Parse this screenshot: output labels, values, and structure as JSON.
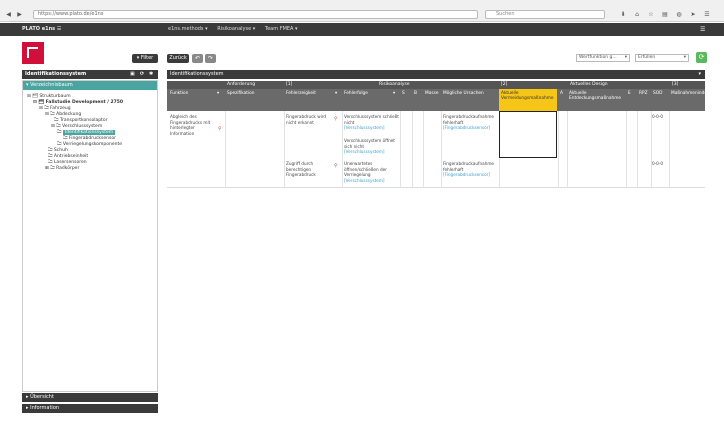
{
  "browser": {
    "url": "https://www.plato.de/e1ns",
    "search_placeholder": "Suchen",
    "back_icon": "back-arrow-icon",
    "forward_icon": "forward-arrow-icon"
  },
  "app": {
    "brand": "PLATO e1ns ☰",
    "breadcrumbs": [
      "e1ns.methods ▾",
      "Risikoanalyse ▾",
      "Team FMEA ▾"
    ]
  },
  "sidebar": {
    "filter_label": "▾ Filter",
    "panel_title": "Identifikationssystem",
    "active_tab": "▾ Verzeichnisbaum",
    "tree": [
      "⊟ 🗂 Strukturbaum",
      "⊟ 🗂 Fallstudie Development / 2750",
      "⊟ 🗀 Fahrzeug",
      "⊟ 🗀 Abdeckung",
      "🗀 Transportkonsolaptor",
      "⊟ 🗀 Verschlusssystem",
      "Identifikationssystem",
      "🗀 Fingerabdrucksensor",
      "🗀 Verriegelungskomponente",
      "🗀 Schuh",
      "🗀 Antriebseinheit",
      "🗀 Lasersensoren",
      "⊞ 🗀 Radkörper"
    ],
    "footer": [
      "▸ Übersicht",
      "▸ Information"
    ]
  },
  "toolbar": {
    "back_label": "Zurück",
    "select1": "Wertfunktion g...",
    "select2": "Erfüllen"
  },
  "main": {
    "title": "Identifikationssystem",
    "band1": [
      "Anforderung",
      "[1]",
      "Risikoanalyse",
      "[2]",
      "Aktuelles Design",
      "[3]"
    ],
    "columns": [
      "Funktion",
      "Spezifikation",
      "Fehlerzeigkeit",
      "Fehlerfolge",
      "S",
      "B",
      "Masse",
      "Mögliche Ursachen",
      "Aktuelle Vermeidungsmaßnahme",
      "A",
      "Aktuelle Entdeckungsmaßnahme",
      "E",
      "RPZ",
      "SOD",
      "Maßnahmenindex"
    ],
    "function_cell": "Abgleich des Fingerabdrucks mit hinterlegter Information",
    "failures": [
      "Fingerabdruck wird nicht erkannt",
      "Zugriff durch berechtigen Fingerabdruck"
    ],
    "effects": [
      {
        "text": "Verschlusssystem schließt nicht",
        "link": "[Verschlusssystem]"
      },
      {
        "text": "Verschlusssystem öffnet sich nicht",
        "link": "[Verschlusssystem]"
      },
      {
        "text": "Unerwartetes öffnen/schließen der Verriegelung",
        "link": "[Verschlusssystem]"
      }
    ],
    "causes": [
      {
        "text": "Fingerabdruckaufnahme fehlerhaft",
        "link": "[Fingerabdrucksensor]"
      },
      {
        "text": "Fingerabdruckaufnahme fehlerhaft",
        "link": "[Fingerabdrucksensor]"
      }
    ],
    "sod": [
      "0-0-0",
      "0-0-0"
    ]
  }
}
